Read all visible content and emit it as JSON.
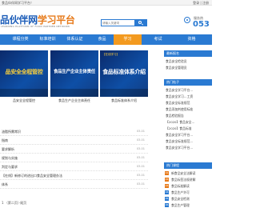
{
  "topbar": {
    "welcome": "食品伙伴网学习平台！",
    "links": "登录 | 注册"
  },
  "header": {
    "logo_main_a": "品伙伴网",
    "logo_main_b": "学习平台",
    "logo_sub": "LEARNING PLATFORM OF FOOD PARTNER NETWORK",
    "search_placeholder": "请输入关键词",
    "search_icon": "search-icon",
    "hotline_label": "服务热",
    "hotline_number": "053"
  },
  "nav": {
    "items": [
      {
        "label": "课程分类"
      },
      {
        "label": "标准培训"
      },
      {
        "label": "体系认证"
      },
      {
        "label": "食品"
      },
      {
        "label": "学习"
      },
      {
        "label": "考试"
      },
      {
        "label": "资格"
      }
    ],
    "active_index": 4
  },
  "banners": [
    {
      "tag": "",
      "title": "品安全全程管控",
      "caption": "品安全全程管控"
    },
    {
      "tag": "",
      "title": "食品生产企业主体责任",
      "caption": "食品生产企业主体责任"
    },
    {
      "tag": "【在线学习】",
      "title": "食品标准体系介绍",
      "caption": "食品标准体系介绍"
    }
  ],
  "list": [
    {
      "title": "油脂所需常识",
      "date": "03-01"
    },
    {
      "title": "指南",
      "date": "03-01"
    },
    {
      "title": "要求解析",
      "date": "03-01"
    },
    {
      "title": "规划与实施",
      "date": "03-01"
    },
    {
      "title": "判定与要求",
      "date": "03-01"
    },
    {
      "title": "【在线】新修订的进出口食品安全管理办法",
      "date": "03-01"
    },
    {
      "title": "体系",
      "date": "03-01"
    }
  ],
  "pager": {
    "text": "1 （第二页）·尾页"
  },
  "sidebar": {
    "section1_title": "最新报名",
    "section1_items": [
      {
        "text": "食品安全检验员"
      },
      {
        "text": "食品安全管理员"
      }
    ],
    "section2_title": "热门帖子",
    "section2_items": [
      {
        "text": "食品安全学习平台…"
      },
      {
        "text": "食品安全学习…工资"
      },
      {
        "text": "食品安全标准规范"
      },
      {
        "text": "食品添加剂使用标准"
      },
      {
        "text": "食品检验报告"
      },
      {
        "text": "【2020】食品安全…"
      },
      {
        "text": "【2020】食品标准"
      },
      {
        "text": "食品安全学习平台…"
      },
      {
        "text": "食品安全标准规范…"
      },
      {
        "text": "食品安全学习平台…"
      }
    ],
    "section3_title": "热门课程",
    "section3_items": [
      {
        "num": "01",
        "text": "新食品安全法解读"
      },
      {
        "num": "02",
        "text": "食品标签法规讲解"
      },
      {
        "num": "03",
        "text": "食品标准解读"
      },
      {
        "num": "04",
        "text": "食品生产许可"
      },
      {
        "num": "05",
        "text": "食品安全检测"
      },
      {
        "num": "06",
        "text": "食品生产管理"
      }
    ]
  }
}
